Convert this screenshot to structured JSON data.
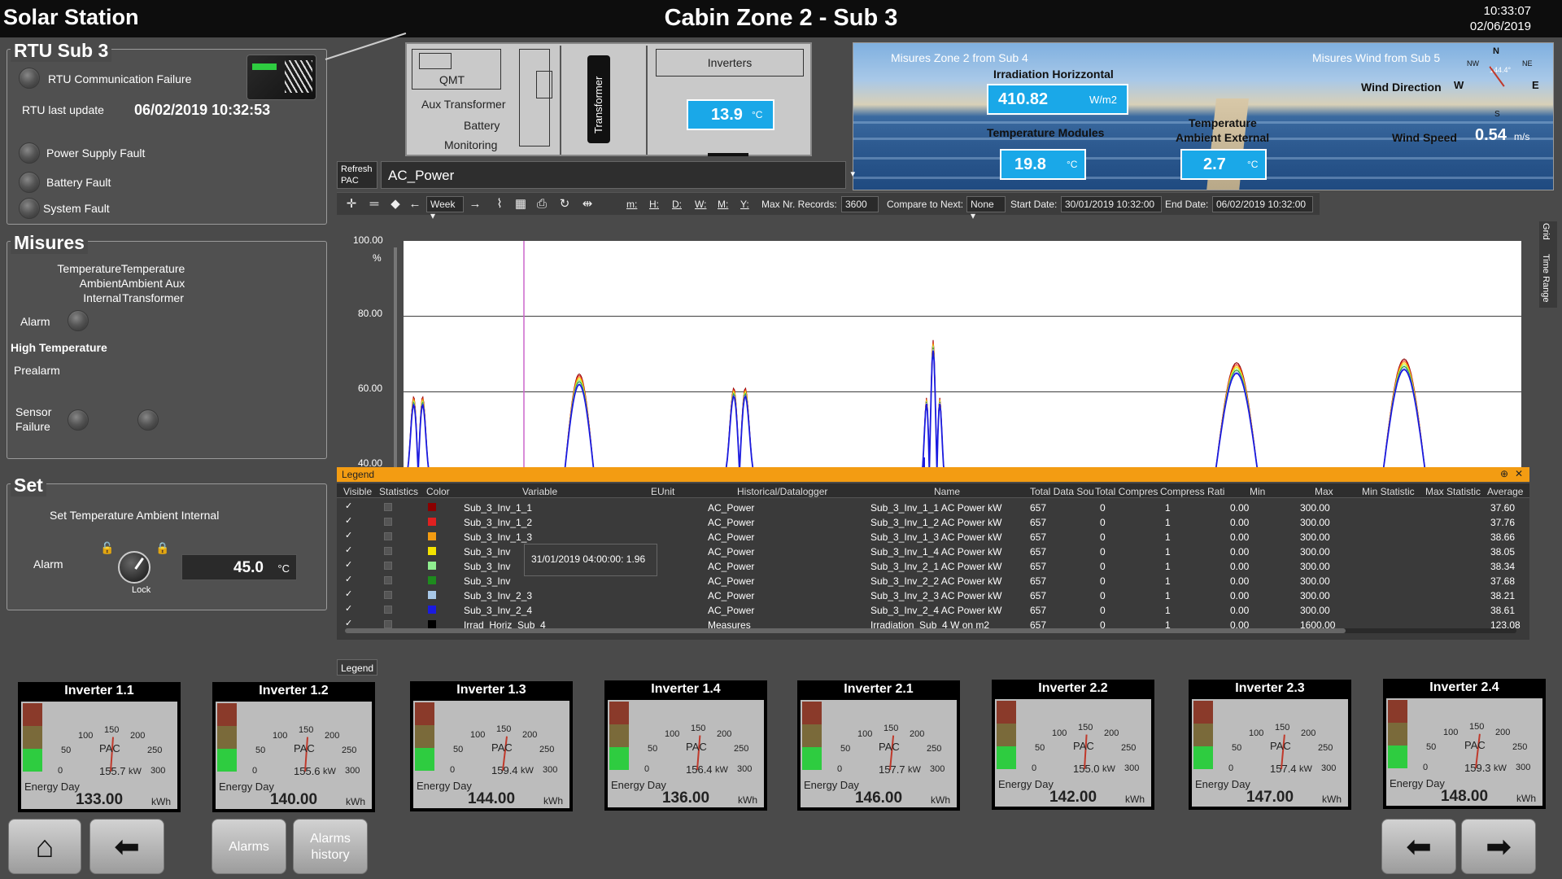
{
  "header": {
    "app_title": "Solar Station",
    "zone_title": "Cabin Zone 2 - Sub 3",
    "time": "10:33:07",
    "date": "02/06/2019"
  },
  "rtu": {
    "title": "RTU Sub 3",
    "comm_failure": "RTU Communication Failure",
    "last_update_label": "RTU last update",
    "last_update_value": "06/02/2019 10:32:53",
    "power_supply_fault": "Power Supply Fault",
    "battery_fault": "Battery Fault",
    "system_fault": "System Fault"
  },
  "misures": {
    "title": "Misures",
    "col1": "Temperature Ambient Internal",
    "col2": "Temperature Ambient Aux Transformer",
    "alarm": "Alarm",
    "high_temp": "High Temperature",
    "prealarm": "Prealarm",
    "sensor_failure": "Sensor Failure"
  },
  "set": {
    "title": "Set",
    "subtitle": "Set Temperature Ambient Internal",
    "alarm": "Alarm",
    "lock": "Lock",
    "value": "45.0",
    "unit": "°C"
  },
  "schematic": {
    "qmt": "QMT",
    "aux_transformer": "Aux Transformer",
    "battery": "Battery",
    "monitoring": "Monitoring",
    "transformer": "Transformer",
    "inverters": "Inverters",
    "inverter_temp": "13.9",
    "inverter_temp_unit": "°C"
  },
  "weather": {
    "zone_title": "Misures Zone 2 from Sub 4",
    "wind_title": "Misures Wind from Sub 5",
    "irradiation_label": "Irradiation Horizzontal",
    "irradiation_value": "410.82",
    "irradiation_unit": "W/m2",
    "temp_modules_label": "Temperature Modules",
    "temp_modules_value": "19.8",
    "temp_modules_unit": "°C",
    "temp_ambient_label_1": "Temperature",
    "temp_ambient_label_2": "Ambient External",
    "temp_ambient_value": "2.7",
    "temp_ambient_unit": "°C",
    "wind_direction_label": "Wind Direction",
    "wind_speed_label": "Wind Speed",
    "wind_speed_value": "0.54",
    "wind_speed_unit": "m/s",
    "compass_n": "N",
    "compass_ne": "NE",
    "compass_nw": "NW",
    "compass_w": "W",
    "compass_e": "E",
    "compass_s": "S",
    "wind_degree": "144.4°"
  },
  "trend": {
    "refresh": "Refresh PAC",
    "variable": "AC_Power",
    "period": "Week",
    "max_records_label": "Max Nr. Records:",
    "max_records": "3600",
    "compare_label": "Compare to Next:",
    "compare_value": "None",
    "start_label": "Start Date:",
    "start_value": "30/01/2019 10:32:00",
    "end_label": "End Date:",
    "end_value": "06/02/2019 10:32:00",
    "tb_m": "m:",
    "tb_h": "H:",
    "tb_d": "D:",
    "tb_w": "W:",
    "tb_M": "M:",
    "tb_y": "Y:",
    "side_grid": "Grid",
    "side_time_range": "Time Range"
  },
  "chart_data": {
    "type": "line",
    "ylabel": "%",
    "ylim": [
      40,
      100
    ],
    "yticks": [
      "100.00",
      "80.00",
      "60.00",
      "40.00"
    ],
    "series": [
      {
        "name": "Sub_3_Inv_1_1",
        "color": "#8b0000"
      },
      {
        "name": "Sub_3_Inv_1_2",
        "color": "#e02020"
      },
      {
        "name": "Sub_3_Inv_1_3",
        "color": "#f39c12"
      },
      {
        "name": "Sub_3_Inv_1_4",
        "color": "#f4e300"
      },
      {
        "name": "Sub_3_Inv_2_1",
        "color": "#90ee90"
      },
      {
        "name": "Sub_3_Inv_2_2",
        "color": "#1e8b1e"
      },
      {
        "name": "Sub_3_Inv_2_3",
        "color": "#a8c8e8"
      },
      {
        "name": "Sub_3_Inv_2_4",
        "color": "#1a1ae0"
      }
    ],
    "peaks": [
      {
        "day": 0.05,
        "value": 66
      },
      {
        "day": 1.0,
        "value": 66
      },
      {
        "day": 2.0,
        "value": 69
      },
      {
        "day": 3.0,
        "value": 75
      },
      {
        "day": 4.0,
        "value": 69
      },
      {
        "day": 5.0,
        "value": 70
      }
    ]
  },
  "legend": {
    "title": "Legend",
    "footer": "Legend",
    "tooltip": "31/01/2019 04:00:00: 1.96",
    "headers": [
      "Visible",
      "Statistics",
      "Color",
      "Variable",
      "EUnit",
      "Historical/Datalogger",
      "Name",
      "Total Data Sou",
      "Total Compres",
      "Compress Rati",
      "Min",
      "Max",
      "Min Statistic",
      "Max Statistic",
      "Average"
    ],
    "rows": [
      {
        "variable": "Sub_3_Inv_1_1",
        "color": "#8b0000",
        "hist": "AC_Power",
        "name": "Sub_3_Inv_1_1   AC Power   kW",
        "total": "657",
        "comp": "0",
        "ratio": "1",
        "min": "0.00",
        "max": "300.00",
        "avg": "37.60"
      },
      {
        "variable": "Sub_3_Inv_1_2",
        "color": "#e02020",
        "hist": "AC_Power",
        "name": "Sub_3_Inv_1_2   AC Power   kW",
        "total": "657",
        "comp": "0",
        "ratio": "1",
        "min": "0.00",
        "max": "300.00",
        "avg": "37.76"
      },
      {
        "variable": "Sub_3_Inv_1_3",
        "color": "#f39c12",
        "hist": "AC_Power",
        "name": "Sub_3_Inv_1_3   AC Power   kW",
        "total": "657",
        "comp": "0",
        "ratio": "1",
        "min": "0.00",
        "max": "300.00",
        "avg": "38.66"
      },
      {
        "variable": "Sub_3_Inv",
        "color": "#f4e300",
        "hist": "AC_Power",
        "name": "Sub_3_Inv_1_4   AC Power   kW",
        "total": "657",
        "comp": "0",
        "ratio": "1",
        "min": "0.00",
        "max": "300.00",
        "avg": "38.05"
      },
      {
        "variable": "Sub_3_Inv",
        "color": "#90ee90",
        "hist": "AC_Power",
        "name": "Sub_3_Inv_2_1   AC Power   kW",
        "total": "657",
        "comp": "0",
        "ratio": "1",
        "min": "0.00",
        "max": "300.00",
        "avg": "38.34"
      },
      {
        "variable": "Sub_3_Inv",
        "color": "#1e8b1e",
        "hist": "AC_Power",
        "name": "Sub_3_Inv_2_2   AC Power   kW",
        "total": "657",
        "comp": "0",
        "ratio": "1",
        "min": "0.00",
        "max": "300.00",
        "avg": "37.68"
      },
      {
        "variable": "Sub_3_Inv_2_3",
        "color": "#a8c8e8",
        "hist": "AC_Power",
        "name": "Sub_3_Inv_2_3   AC Power   kW",
        "total": "657",
        "comp": "0",
        "ratio": "1",
        "min": "0.00",
        "max": "300.00",
        "avg": "38.21"
      },
      {
        "variable": "Sub_3_Inv_2_4",
        "color": "#1a1ae0",
        "hist": "AC_Power",
        "name": "Sub_3_Inv_2_4   AC Power   kW",
        "total": "657",
        "comp": "0",
        "ratio": "1",
        "min": "0.00",
        "max": "300.00",
        "avg": "38.61"
      },
      {
        "variable": "Irrad_Horiz_Sub_4",
        "color": "#000000",
        "hist": "Measures",
        "name": "Irradiation_Sub_4   W on m2",
        "total": "657",
        "comp": "0",
        "ratio": "1",
        "min": "0.00",
        "max": "1600.00",
        "avg": "123.08"
      }
    ]
  },
  "inverters": [
    {
      "title": "Inverter 1.1",
      "pac": "155.7",
      "energy": "133.00",
      "pac_value": 155.7
    },
    {
      "title": "Inverter 1.2",
      "pac": "155.6",
      "energy": "140.00",
      "pac_value": 155.6
    },
    {
      "title": "Inverter 1.3",
      "pac": "159.4",
      "energy": "144.00",
      "pac_value": 159.4
    },
    {
      "title": "Inverter 1.4",
      "pac": "156.4",
      "energy": "136.00",
      "pac_value": 156.4
    },
    {
      "title": "Inverter 2.1",
      "pac": "157.7",
      "energy": "146.00",
      "pac_value": 157.7
    },
    {
      "title": "Inverter 2.2",
      "pac": "155.0",
      "energy": "142.00",
      "pac_value": 155.0
    },
    {
      "title": "Inverter 2.3",
      "pac": "157.4",
      "energy": "147.00",
      "pac_value": 157.4
    },
    {
      "title": "Inverter 2.4",
      "pac": "159.3",
      "energy": "148.00",
      "pac_value": 159.3
    }
  ],
  "gauge": {
    "ticks": [
      "0",
      "50",
      "100",
      "150",
      "200",
      "250",
      "300"
    ],
    "label": "PAC",
    "unit": "kW",
    "energy_label": "Energy Day",
    "energy_unit": "kWh"
  },
  "buttons": {
    "home": "home-icon",
    "back": "arrow-left-icon",
    "alarms": "Alarms",
    "alarms_history": "Alarms history",
    "prev": "arrow-left-icon",
    "next": "arrow-right-icon"
  }
}
